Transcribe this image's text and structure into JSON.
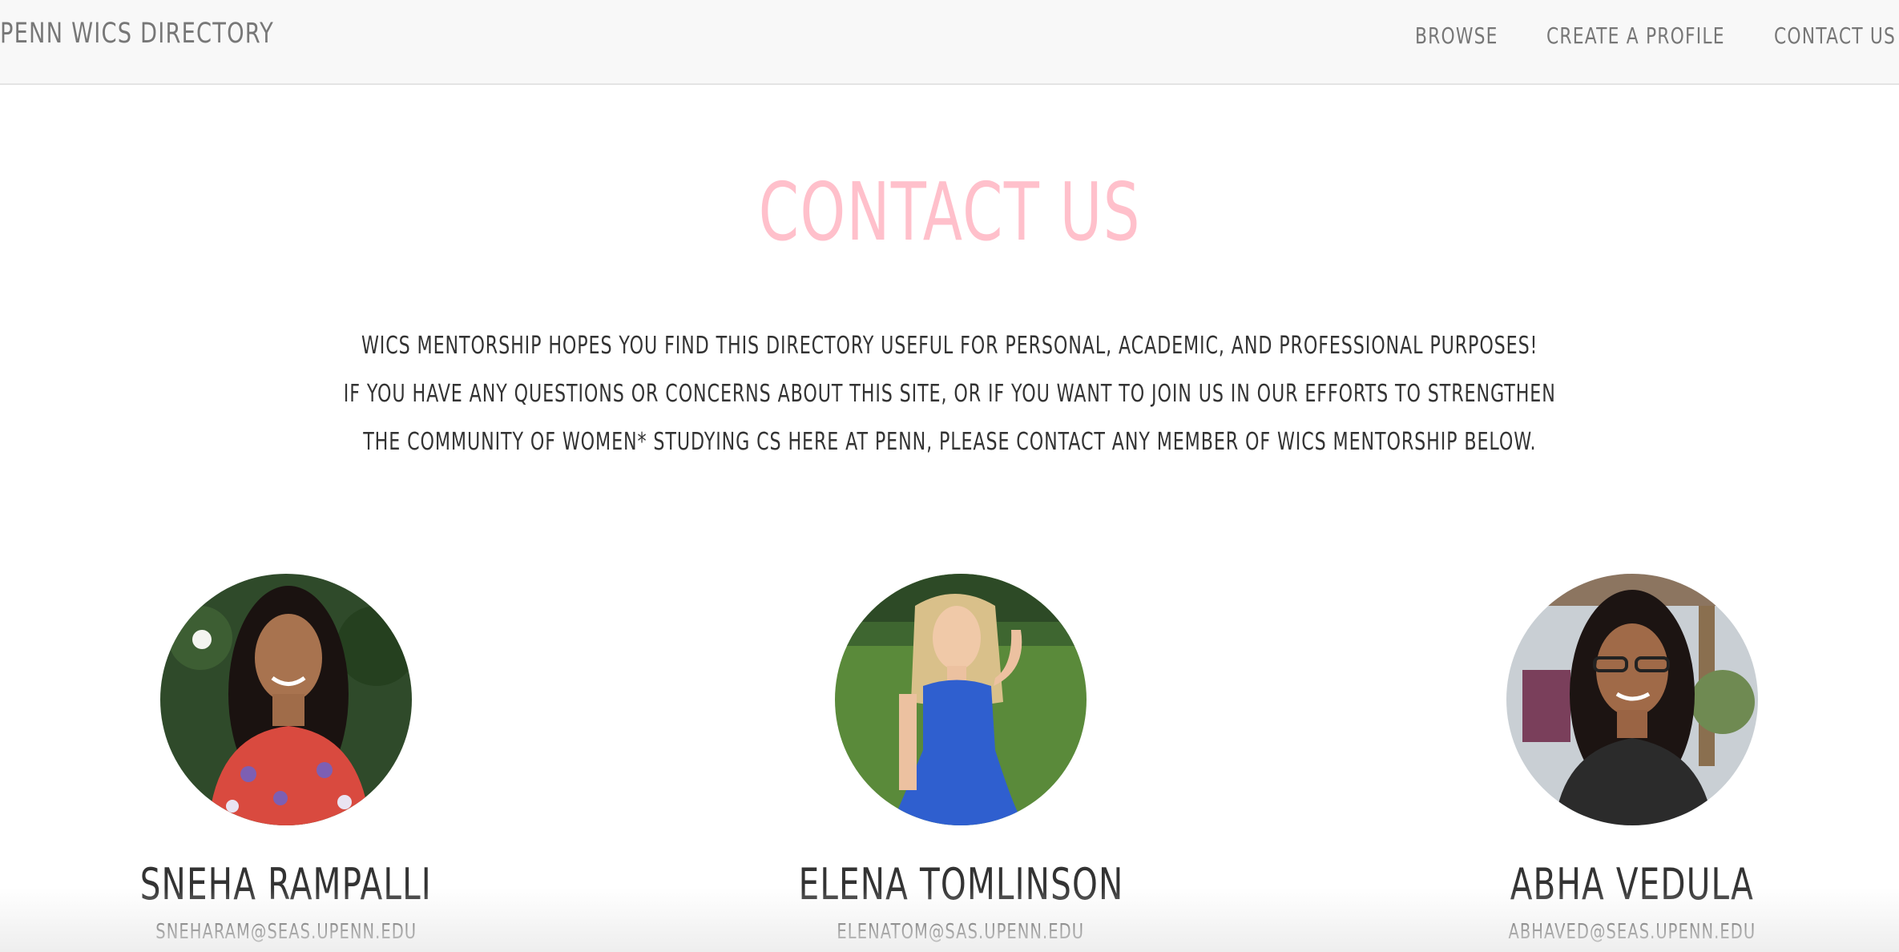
{
  "navbar": {
    "brand": "PENN WICS DIRECTORY",
    "links": [
      {
        "label": "BROWSE"
      },
      {
        "label": "CREATE A PROFILE"
      },
      {
        "label": "CONTACT US"
      }
    ]
  },
  "main": {
    "title": "CONTACT US",
    "intro_lines": [
      "WICS MENTORSHIP HOPES YOU FIND THIS DIRECTORY USEFUL FOR PERSONAL, ACADEMIC, AND PROFESSIONAL PURPOSES!",
      "IF YOU HAVE ANY QUESTIONS OR CONCERNS ABOUT THIS SITE, OR IF YOU WANT TO JOIN US IN OUR EFFORTS TO STRENGTHEN",
      "THE COMMUNITY OF WOMEN* STUDYING CS HERE AT PENN, PLEASE CONTACT ANY MEMBER OF WICS MENTORSHIP BELOW."
    ],
    "members": [
      {
        "name": "SNEHA RAMPALLI",
        "email": "SNEHARAM@SEAS.UPENN.EDU"
      },
      {
        "name": "ELENA TOMLINSON",
        "email": "ELENATOM@SAS.UPENN.EDU"
      },
      {
        "name": "ABHA VEDULA",
        "email": "ABHAVED@SEAS.UPENN.EDU"
      }
    ]
  },
  "colors": {
    "title_pink": "#ffc0cb",
    "nav_text": "#777777",
    "body_text": "#333333",
    "navbar_bg": "#f8f8f8"
  }
}
